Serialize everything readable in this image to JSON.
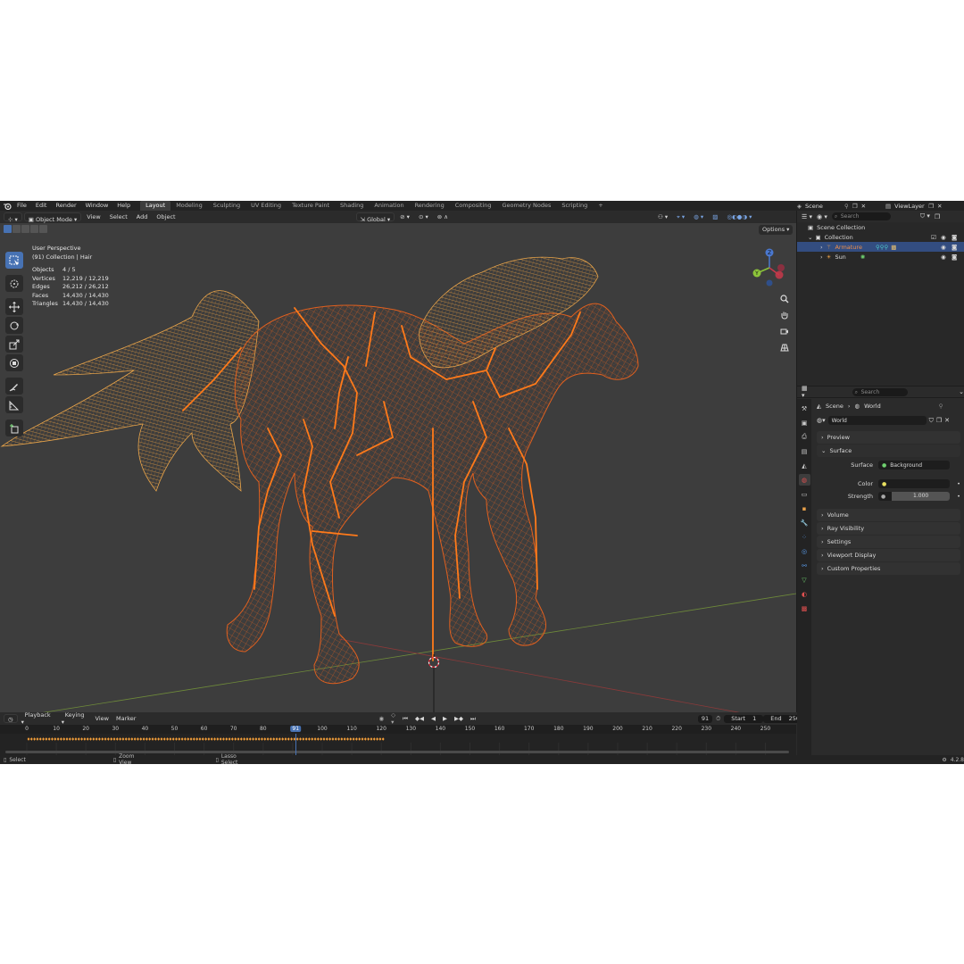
{
  "menu": [
    "File",
    "Edit",
    "Render",
    "Window",
    "Help"
  ],
  "workspaces": [
    "Layout",
    "Modeling",
    "Sculpting",
    "UV Editing",
    "Texture Paint",
    "Shading",
    "Animation",
    "Rendering",
    "Compositing",
    "Geometry Nodes",
    "Scripting",
    "+"
  ],
  "active_workspace": "Layout",
  "scene_name": "Scene",
  "view_layer": "ViewLayer",
  "viewport": {
    "mode": "Object Mode",
    "menus": [
      "View",
      "Select",
      "Add",
      "Object"
    ],
    "transform": "Global",
    "options_label": "Options",
    "perspective": "User Perspective",
    "context": "(91) Collection | Hair",
    "stats": [
      {
        "k": "Objects",
        "v": "4 / 5"
      },
      {
        "k": "Vertices",
        "v": "12,219 / 12,219"
      },
      {
        "k": "Edges",
        "v": "26,212 / 26,212"
      },
      {
        "k": "Faces",
        "v": "14,430 / 14,430"
      },
      {
        "k": "Triangles",
        "v": "14,430 / 14,430"
      }
    ],
    "gizmo": {
      "x": "X",
      "y": "Y",
      "z": "Z"
    }
  },
  "timeline": {
    "menus": [
      "Playback",
      "Keying",
      "View",
      "Marker"
    ],
    "current_frame": "91",
    "start_label": "Start",
    "start": "1",
    "end_label": "End",
    "end": "250",
    "ticks": [
      "0",
      "10",
      "20",
      "30",
      "40",
      "50",
      "60",
      "70",
      "80",
      "91",
      "100",
      "110",
      "120",
      "130",
      "140",
      "150",
      "160",
      "170",
      "180",
      "190",
      "200",
      "210",
      "220",
      "230",
      "240",
      "250"
    ]
  },
  "status": {
    "select": "Select",
    "zoom": "Zoom View",
    "lasso": "Lasso Select",
    "version": "4.2.8"
  },
  "outliner": {
    "search_placeholder": "Search",
    "scene_collection": "Scene Collection",
    "collection": "Collection",
    "armature": "Armature",
    "sun": "Sun"
  },
  "properties": {
    "search_placeholder": "Search",
    "crumb_scene": "Scene",
    "crumb_world": "World",
    "world_name": "World",
    "panels": {
      "preview": "Preview",
      "surface": "Surface",
      "volume": "Volume",
      "ray_visibility": "Ray Visibility",
      "settings": "Settings",
      "viewport_display": "Viewport Display",
      "custom_properties": "Custom Properties"
    },
    "surface_label": "Surface",
    "surface_value": "Background",
    "color_label": "Color",
    "strength_label": "Strength",
    "strength_value": "1.000"
  },
  "colors": {
    "accent": "#4772b3",
    "wire": "#e0601f",
    "hair": "#e09a3c",
    "bone": "#ff7a1a",
    "viewport_bg": "#3d3d3d"
  }
}
